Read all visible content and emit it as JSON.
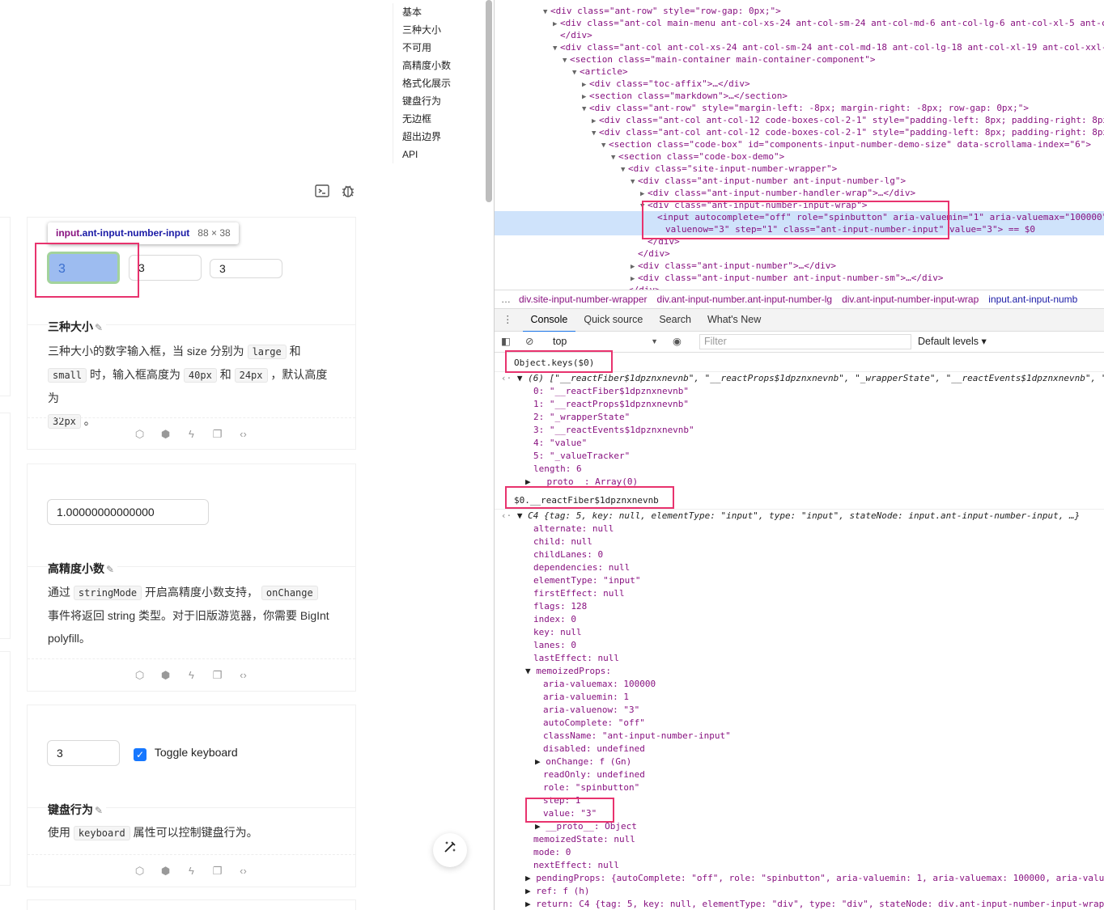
{
  "toc": [
    "基本",
    "三种大小",
    "不可用",
    "高精度小数",
    "格式化展示",
    "键盘行为",
    "无边框",
    "超出边界",
    "API"
  ],
  "tooltip": {
    "tag": "input",
    "cls": ".ant-input-number-input",
    "dim": "88 × 38"
  },
  "size_demo": {
    "large": "3",
    "middle": "3",
    "small": "3",
    "title": "三种大小",
    "desc_1": "三种大小的数字输入框，当 size 分别为",
    "code_large": "large",
    "desc_2": "和",
    "code_small": "small",
    "desc_3": "时，输入框高度为",
    "code_40": "40px",
    "desc_4": "和",
    "code_24": "24px",
    "desc_5": "，默认高度为",
    "code_32": "32px",
    "desc_6": "。"
  },
  "precision_demo": {
    "value": "1.00000000000000",
    "title": "高精度小数",
    "desc_1": "通过",
    "code_1": "stringMode",
    "desc_2": "开启高精度小数支持，",
    "code_2": "onChange",
    "desc_3": "事件将返回 string 类型。对于旧版游览器，你需要 BigInt polyfill。"
  },
  "keyboard_demo": {
    "value": "3",
    "checkbox_label": "Toggle keyboard",
    "title": "键盘行为",
    "desc_1": "使用",
    "code_1": "keyboard",
    "desc_2": "属性可以控制键盘行为。"
  },
  "elements": [
    "<div class=\"ant-row\" style=\"row-gap: 0px;\">",
    "<div class=\"ant-col main-menu ant-col-xs-24 ant-col-sm-24 ant-col-md-6 ant-col-lg-6 ant-col-xl-5 ant-co",
    "</div>",
    "<div class=\"ant-col ant-col-xs-24 ant-col-sm-24 ant-col-md-18 ant-col-lg-18 ant-col-xl-19 ant-col-xxl-2",
    "<section class=\"main-container main-container-component\">",
    "<article>",
    "<div class=\"toc-affix\">…</div>",
    "<section class=\"markdown\">…</section>",
    "<div class=\"ant-row\" style=\"margin-left: -8px; margin-right: -8px; row-gap: 0px;\">",
    "<div class=\"ant-col ant-col-12 code-boxes-col-2-1\" style=\"padding-left: 8px; padding-right: 8px;",
    "<div class=\"ant-col ant-col-12 code-boxes-col-2-1\" style=\"padding-left: 8px; padding-right: 8px;",
    "<section class=\"code-box\" id=\"components-input-number-demo-size\" data-scrollama-index=\"6\">",
    "<section class=\"code-box-demo\">",
    "<div class=\"site-input-number-wrapper\">",
    "<div class=\"ant-input-number ant-input-number-lg\">",
    "<div class=\"ant-input-number-handler-wrap\">…</div>",
    "<div class=\"ant-input-number-input-wrap\">",
    "<input autocomplete=\"off\" role=\"spinbutton\" aria-valuemin=\"1\" aria-valuemax=\"100000\"",
    "valuenow=\"3\" step=\"1\" class=\"ant-input-number-input\" value=\"3\"> == $0",
    "</div>",
    "</div>",
    "<div class=\"ant-input-number\">…</div>",
    "<div class=\"ant-input-number ant-input-number-sm\">…</div>",
    "</div>"
  ],
  "crumbs": [
    "div.site-input-number-wrapper",
    "div.ant-input-number.ant-input-number-lg",
    "div.ant-input-number-input-wrap",
    "input.ant-input-numb"
  ],
  "tabs": [
    "Console",
    "Quick source",
    "Search",
    "What's New"
  ],
  "console_toolbar": {
    "context": "top",
    "filter_placeholder": "Filter",
    "levels": "Default levels"
  },
  "cmd1": "Object.keys($0)",
  "keys_summary": "(6) [\"__reactFiber$1dpznxnevnb\", \"__reactProps$1dpznxnevnb\", \"_wrapperState\", \"__reactEvents$1dpznxnevnb\", \"v",
  "keys": [
    "0: \"__reactFiber$1dpznxnevnb\"",
    "1: \"__reactProps$1dpznxnevnb\"",
    "2: \"_wrapperState\"",
    "3: \"__reactEvents$1dpznxnevnb\"",
    "4: \"value\"",
    "5: \"_valueTracker\"",
    "length: 6",
    "__proto__: Array(0)"
  ],
  "cmd2": "$0.__reactFiber$1dpznxnevnb",
  "fiber_summary": "C4 {tag: 5, key: null, elementType: \"input\", type: \"input\", stateNode: input.ant-input-number-input, …}",
  "fiber": [
    "alternate: null",
    "child: null",
    "childLanes: 0",
    "dependencies: null",
    "elementType: \"input\"",
    "firstEffect: null",
    "flags: 128",
    "index: 0",
    "key: null",
    "lanes: 0",
    "lastEffect: null",
    "memoizedProps:"
  ],
  "props": [
    "aria-valuemax: 100000",
    "aria-valuemin: 1",
    "aria-valuenow: \"3\"",
    "autoComplete: \"off\"",
    "className: \"ant-input-number-input\"",
    "disabled: undefined",
    "onChange: f (Gn)",
    "readOnly: undefined",
    "role: \"spinbutton\"",
    "step: 1",
    "value: \"3\"",
    "__proto__: Object"
  ],
  "fiber2": [
    "memoizedState: null",
    "mode: 0",
    "nextEffect: null",
    "pendingProps: {autoComplete: \"off\", role: \"spinbutton\", aria-valuemin: 1, aria-valuemax: 100000, aria-value",
    "ref: f (h)",
    "return: C4 {tag: 5, key: null, elementType: \"div\", type: \"div\", stateNode: div.ant-input-number-input-wrap,"
  ]
}
